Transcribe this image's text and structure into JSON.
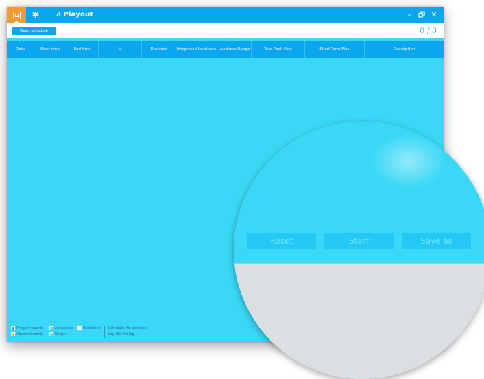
{
  "titlebar": {
    "app_name_prefix": "LA ",
    "app_name_main": "Playout",
    "home_icon": "playout-icon",
    "settings_icon": "gear-icon",
    "minimize_glyph": "–",
    "restore_glyph": "🗗",
    "close_glyph": "✕"
  },
  "toolbar": {
    "open_schedule_label": "Open schedule",
    "counter": "0 / 0"
  },
  "table": {
    "columns": [
      "Date",
      "Start time",
      "End time",
      "Id",
      "Duration",
      "Integrated Loudness",
      "Loudness Range",
      "True Peak Max",
      "Short-Term Max",
      "Description"
    ]
  },
  "legend": {
    "program_events": "Program events",
    "advertisements": "Advertisements",
    "announces": "Announces",
    "stripes": "Stripes",
    "undefined": "Undefined",
    "schedule": "Schedule: No schedule",
    "log_file": "Log-file: No log",
    "colors": {
      "program_events": "#1aa6ee",
      "advertisements": "#f5b13a",
      "announces": "#7fd2c6",
      "stripes": "#8fcfe0",
      "undefined": "#ffffff"
    }
  },
  "magnifier": {
    "reset_label": "Reset",
    "start_label": "Start",
    "save_as_label": "Save as"
  },
  "colors": {
    "accent": "#0aa6ee",
    "background": "#3ad8f6",
    "home_tab": "#f59a2b"
  }
}
